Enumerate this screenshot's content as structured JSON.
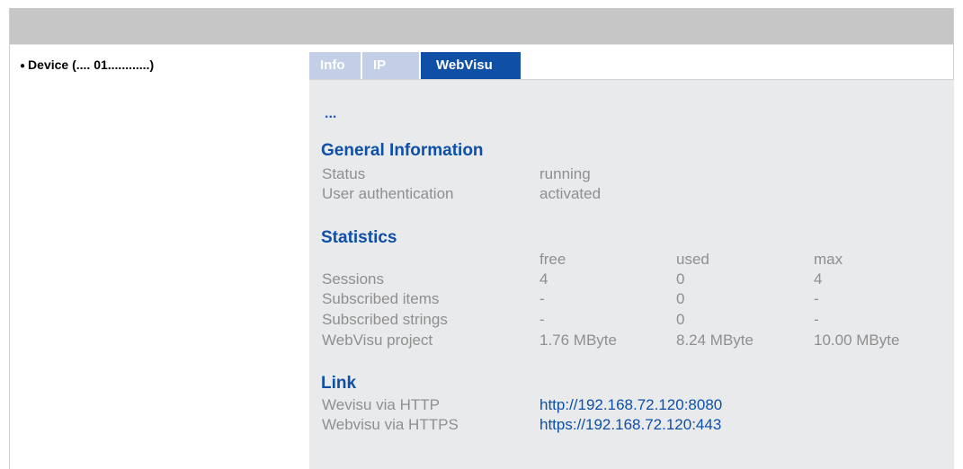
{
  "sidebar": {
    "device_label": "Device (.... 01............)"
  },
  "tabs": {
    "info": "Info",
    "ip": "IP",
    "webvisu": "WebVisu"
  },
  "content": {
    "ellipsis": "...",
    "general": {
      "title": "General Information",
      "status_label": "Status",
      "status_value": "running",
      "auth_label": "User authentication",
      "auth_value": "activated"
    },
    "statistics": {
      "title": "Statistics",
      "columns": [
        "free",
        "used",
        "max"
      ],
      "rows": [
        {
          "label": "Sessions",
          "values": [
            "4",
            "0",
            "4"
          ]
        },
        {
          "label": "Subscribed items",
          "values": [
            "-",
            "0",
            "-"
          ]
        },
        {
          "label": "Subscribed strings",
          "values": [
            "-",
            "0",
            "-"
          ]
        },
        {
          "label": "WebVisu project",
          "values": [
            "1.76 MByte",
            "8.24 MByte",
            "10.00 MByte"
          ]
        }
      ]
    },
    "link": {
      "title": "Link",
      "http_label": "Wevisu via HTTP",
      "http_url": "http://192.168.72.120:8080",
      "https_label": "Webvisu via HTTPS",
      "https_url": "https://192.168.72.120:443"
    }
  },
  "colors": {
    "accent": "#0f4fa6",
    "tab_inactive": "#c2cfe6",
    "panel_bg": "#e8eaec",
    "text_muted": "#8f8f8f",
    "topbar": "#c6c6c6"
  }
}
